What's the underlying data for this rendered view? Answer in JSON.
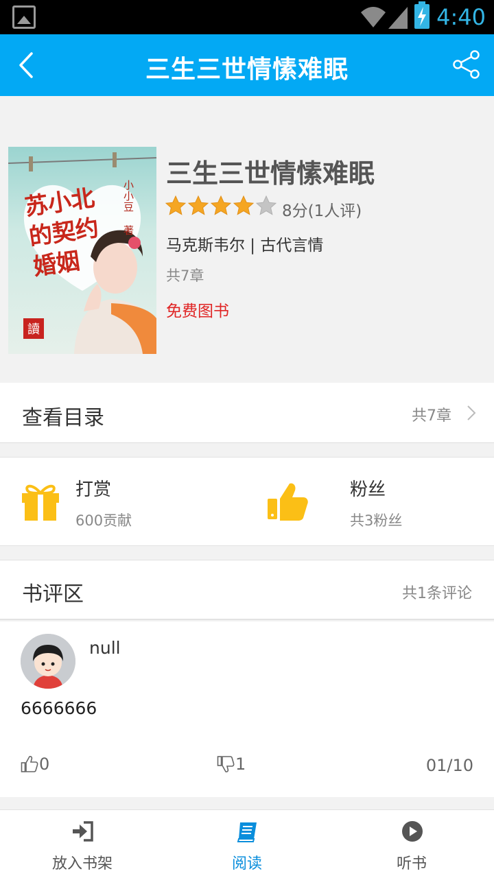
{
  "status_bar": {
    "time": "4:40"
  },
  "header": {
    "title": "三生三世情愫难眠"
  },
  "book": {
    "cover_text": "苏小北的契约婚姻",
    "cover_author": "小小豆",
    "cover_author_suffix": "著",
    "title": "三生三世情愫难眠",
    "stars": 4,
    "rating_text": "8分(1人评)",
    "author_category": "马克斯韦尔 | 古代言情",
    "chapters": "共7章",
    "price": "免费图书"
  },
  "toc": {
    "label": "查看目录",
    "count": "共7章"
  },
  "reward": {
    "label": "打赏",
    "value": "600贡献"
  },
  "fans": {
    "label": "粉丝",
    "value": "共3粉丝"
  },
  "reviews": {
    "label": "书评区",
    "count": "共1条评论",
    "items": [
      {
        "user": "null",
        "text": "6666666",
        "likes": "0",
        "dislikes": "1",
        "date": "01/10"
      }
    ]
  },
  "bottom_bar": {
    "tabs": [
      {
        "label": "放入书架",
        "icon": "add-to-shelf-icon"
      },
      {
        "label": "阅读",
        "icon": "book-icon"
      },
      {
        "label": "听书",
        "icon": "play-icon"
      }
    ]
  },
  "colors": {
    "primary": "#03a9f4",
    "accent_text": "#0a8edc",
    "star": "#f5a623",
    "free": "#e02424",
    "gift": "#fbbf16"
  }
}
